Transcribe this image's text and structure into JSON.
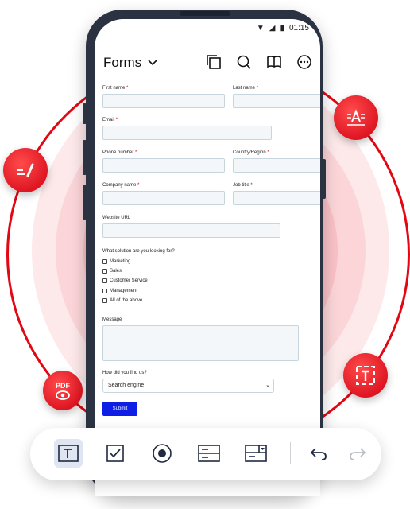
{
  "app": {
    "title": "Forms",
    "status_time": "01:15"
  },
  "toolbar_top": {
    "icons": [
      "pages-icon",
      "search-icon",
      "book-icon",
      "more-icon"
    ]
  },
  "form": {
    "first_name_label": "First name",
    "last_name_label": "Last name",
    "email_label": "Email",
    "phone_label": "Phone number",
    "country_label": "Country/Region",
    "company_label": "Company name",
    "job_label": "Job title",
    "website_label": "Website URL",
    "solution_label": "What solution are you looking for?",
    "options": [
      "Marketing",
      "Sales",
      "Customer Service",
      "Management",
      "All of the above"
    ],
    "message_label": "Message",
    "find_label": "How did you find us?",
    "find_value": "Search engine",
    "submit_label": "Submit",
    "required_mark": "*"
  },
  "badges": {
    "pdf_label": "PDF"
  },
  "bottom_toolbar": {
    "tools": [
      "text-field-tool",
      "checkbox-tool",
      "radio-button-tool",
      "list-box-tool",
      "dropdown-tool"
    ],
    "actions": [
      "undo",
      "redo"
    ]
  },
  "colors": {
    "accent": "#e30613",
    "submit": "#0f1ee6",
    "phone_frame": "#2b3342"
  }
}
